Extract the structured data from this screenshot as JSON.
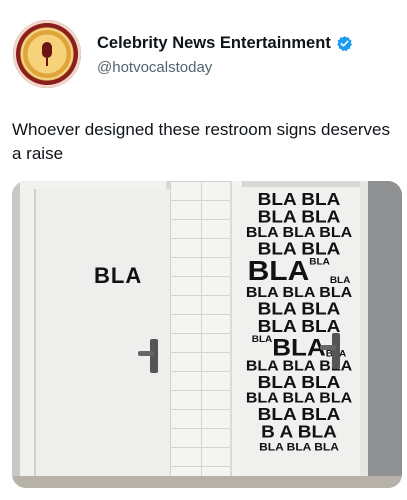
{
  "account": {
    "display_name": "Celebrity News Entertainment",
    "handle": "@hotvocalstoday",
    "verified_color": "#1d9bf0"
  },
  "tweet": {
    "text": "Whoever designed these restroom signs deserves a raise"
  },
  "image": {
    "left_door_sign": "BLA",
    "right_door_lines": [
      "BLA BLA",
      "BLA BLA",
      "BLA BLA BLA",
      "BLA BLA",
      "BLA",
      "BLA",
      "BLA",
      "BLA BLA BLA",
      "BLA BLA",
      "BLA BLA",
      "BLA",
      "BLA",
      "BLA",
      "BLA BLA BLA",
      "BLA BLA",
      "BLA BLA BLA",
      "BLA BLA",
      "B A BLA",
      "BLA BLA BLA"
    ]
  }
}
